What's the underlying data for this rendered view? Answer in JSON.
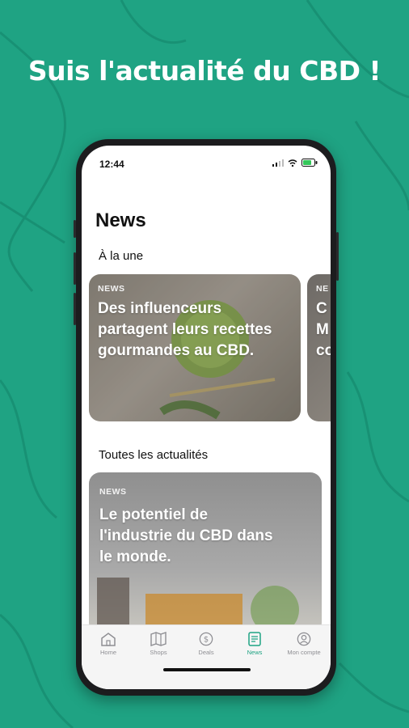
{
  "headline": "Suis l'actualité du CBD !",
  "status_bar": {
    "time": "12:44"
  },
  "page_title": "News",
  "featured": {
    "title": "À la une",
    "cards": [
      {
        "tag": "NEWS",
        "text": "Des influenceurs partagent leurs recettes gourmandes au CBD."
      },
      {
        "tag": "NE",
        "text": "C\nM\nco"
      }
    ]
  },
  "all_news": {
    "title": "Toutes les actualités",
    "cards": [
      {
        "tag": "NEWS",
        "text": "Le potentiel de l'industrie du CBD dans le monde."
      }
    ]
  },
  "tab_bar": {
    "items": [
      {
        "label": "Home",
        "icon": "home-icon",
        "active": false
      },
      {
        "label": "Shops",
        "icon": "map-icon",
        "active": false
      },
      {
        "label": "Deals",
        "icon": "dollar-icon",
        "active": false
      },
      {
        "label": "News",
        "icon": "news-icon",
        "active": true
      },
      {
        "label": "Mon compte",
        "icon": "account-icon",
        "active": false
      }
    ]
  },
  "colors": {
    "brand": "#1fa383",
    "active_tab": "#1fa383",
    "inactive_tab": "#8e8e93"
  }
}
